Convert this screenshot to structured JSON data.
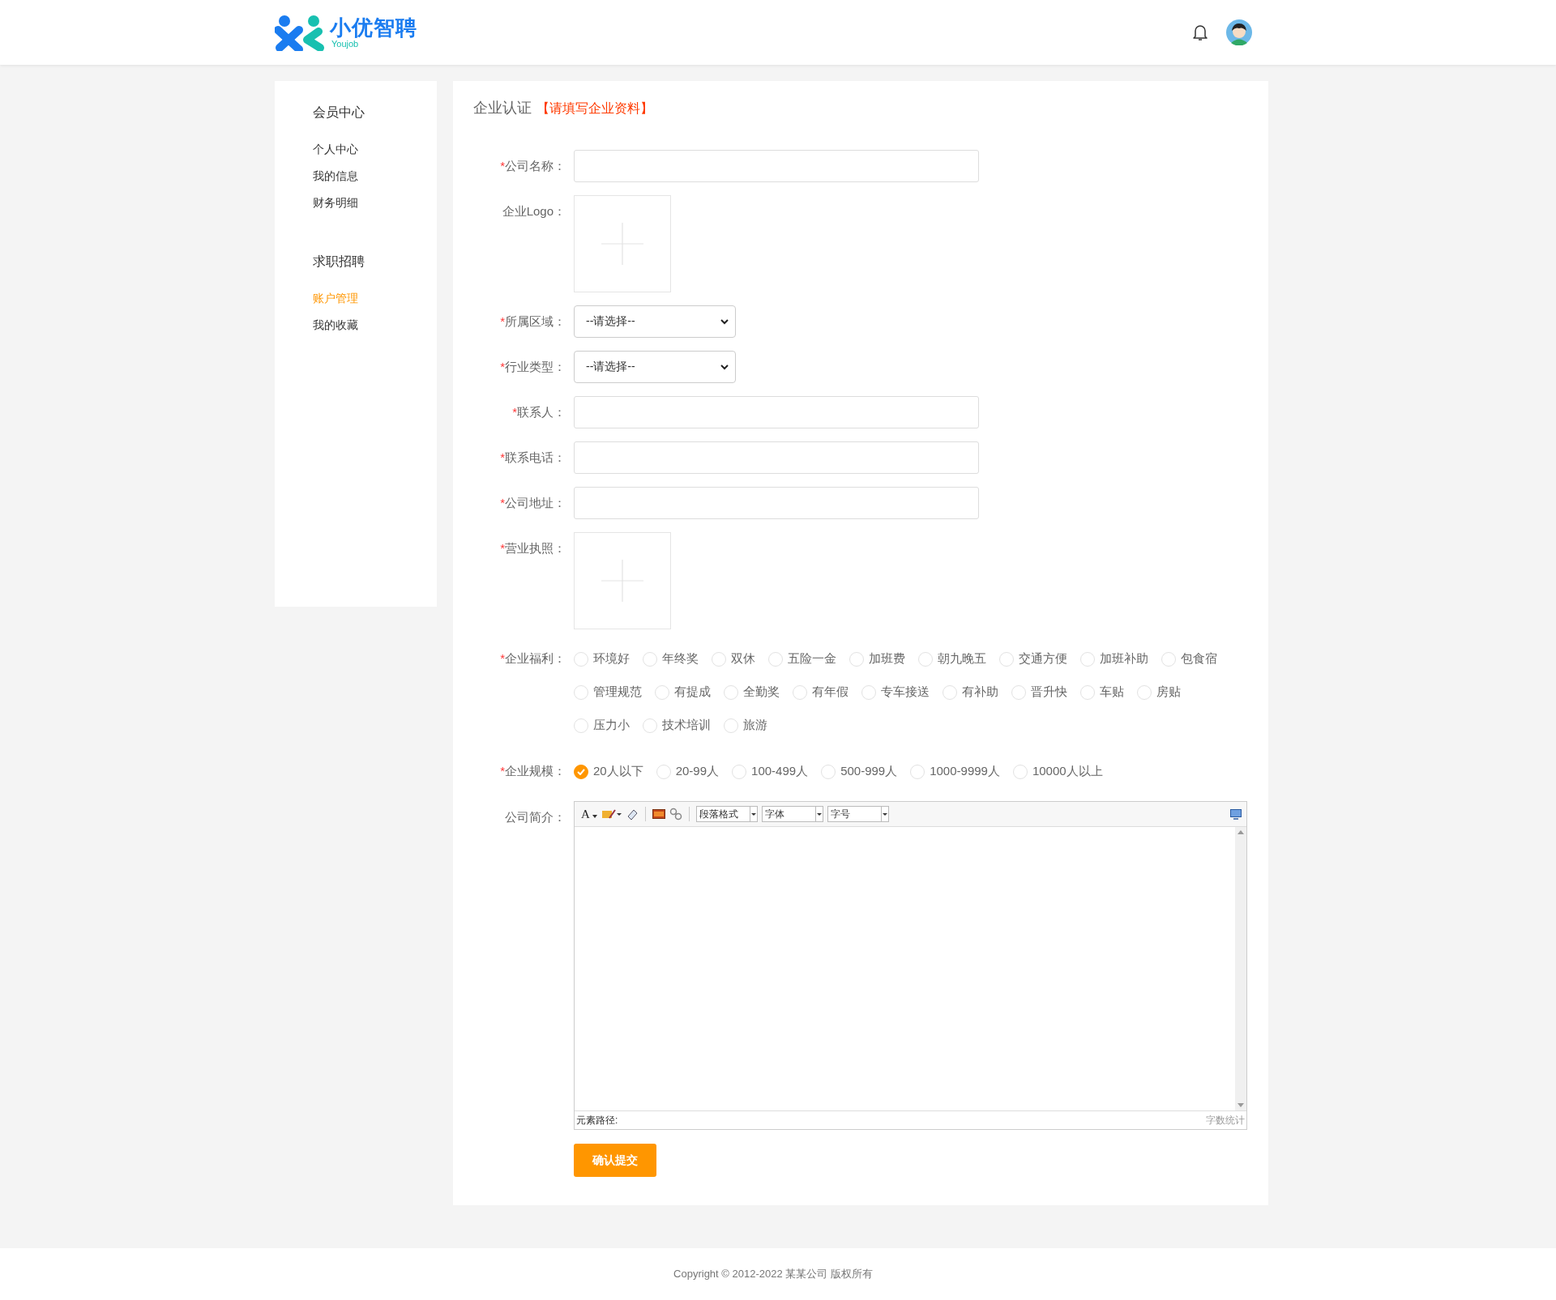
{
  "header": {
    "logo_text": "小优智聘",
    "logo_subtext": "Youjob"
  },
  "sidebar": {
    "sections": [
      {
        "title": "会员中心",
        "items": [
          {
            "label": "个人中心",
            "selected": false
          },
          {
            "label": "我的信息",
            "selected": false
          },
          {
            "label": "财务明细",
            "selected": false
          }
        ]
      },
      {
        "title": "求职招聘",
        "items": [
          {
            "label": "账户管理",
            "selected": true
          },
          {
            "label": "我的收藏",
            "selected": false
          }
        ]
      }
    ]
  },
  "form": {
    "title": "企业认证",
    "subtitle": "【请填写企业资料】",
    "fields": [
      {
        "kind": "text",
        "mark": "*",
        "label": "公司名称："
      },
      {
        "kind": "upload",
        "label": "企业Logo："
      },
      {
        "kind": "select",
        "mark": "*",
        "label": "所属区域：",
        "value": "--请选择--"
      },
      {
        "kind": "select",
        "mark": "*",
        "label": "行业类型：",
        "value": "--请选择--"
      },
      {
        "kind": "text",
        "mark": "*",
        "label": "联系人："
      },
      {
        "kind": "text",
        "mark": "*",
        "label": "联系电话："
      },
      {
        "kind": "text",
        "mark": "*",
        "label": "公司地址："
      },
      {
        "kind": "upload",
        "mark": "*",
        "label": "营业执照："
      },
      {
        "kind": "checkboxes",
        "mark": "*",
        "label": "企业福利：",
        "options": [
          {
            "label": "环境好",
            "checked": false
          },
          {
            "label": "年终奖",
            "checked": false
          },
          {
            "label": "双休",
            "checked": false
          },
          {
            "label": "五险一金",
            "checked": false
          },
          {
            "label": "加班费",
            "checked": false
          },
          {
            "label": "朝九晚五",
            "checked": false
          },
          {
            "label": "交通方便",
            "checked": false
          },
          {
            "label": "加班补助",
            "checked": false
          },
          {
            "label": "包食宿",
            "checked": false
          },
          {
            "label": "管理规范",
            "checked": false
          },
          {
            "label": "有提成",
            "checked": false
          },
          {
            "label": "全勤奖",
            "checked": false
          },
          {
            "label": "有年假",
            "checked": false
          },
          {
            "label": "专车接送",
            "checked": false
          },
          {
            "label": "有补助",
            "checked": false
          },
          {
            "label": "晋升快",
            "checked": false
          },
          {
            "label": "车贴",
            "checked": false
          },
          {
            "label": "房贴",
            "checked": false
          },
          {
            "label": "压力小",
            "checked": false
          },
          {
            "label": "技术培训",
            "checked": false
          },
          {
            "label": "旅游",
            "checked": false
          }
        ]
      },
      {
        "kind": "radios",
        "mark": "*",
        "label": "企业规模：",
        "options": [
          {
            "label": "20人以下",
            "selected": true
          },
          {
            "label": "20-99人",
            "selected": false
          },
          {
            "label": "100-499人",
            "selected": false
          },
          {
            "label": "500-999人",
            "selected": false
          },
          {
            "label": "1000-9999人",
            "selected": false
          },
          {
            "label": "10000人以上",
            "selected": false
          }
        ]
      },
      {
        "kind": "editor",
        "label": "公司简介：",
        "toolbar": [
          {
            "kind": "font-color",
            "glyph": "A"
          },
          {
            "kind": "highlight"
          },
          {
            "kind": "eraser"
          },
          {
            "kind": "separator"
          },
          {
            "kind": "image"
          },
          {
            "kind": "link"
          },
          {
            "kind": "separator"
          },
          {
            "kind": "dropdown",
            "label": "段落格式"
          },
          {
            "kind": "dropdown",
            "label": "字体"
          },
          {
            "kind": "dropdown",
            "label": "字号"
          },
          {
            "kind": "fullscreen"
          }
        ],
        "status_left": "元素路径:",
        "status_right": "字数统计"
      }
    ],
    "submit": "确认提交"
  },
  "footer": {
    "text": "Copyright © 2012-2022 某某公司 版权所有"
  }
}
